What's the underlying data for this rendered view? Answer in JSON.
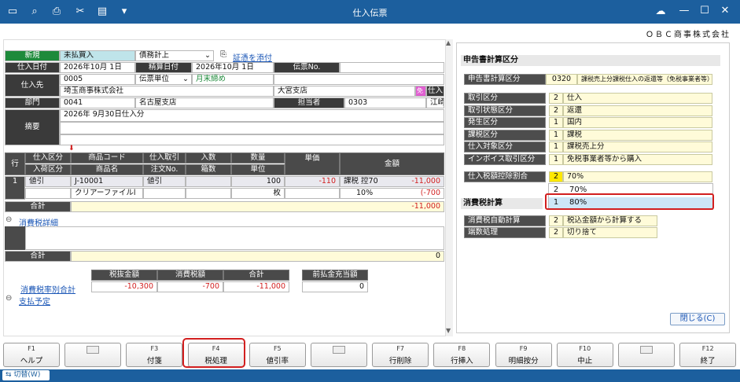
{
  "window": {
    "title": "仕入伝票"
  },
  "company": "ＯＢＣ商事株式会社",
  "header": {
    "new_label": "新規",
    "type_value": "未払買入",
    "debt_value": "債務計上",
    "attach_link": "証憑を添付",
    "date_label": "仕入日付",
    "date_value": "2026年10月  1日",
    "settle_label": "精算日付",
    "settle_value": "2026年10月  1日",
    "slip_label": "伝票No.",
    "supplier_label": "仕入先",
    "supplier_code": "0005",
    "slip_unit": "伝票単位",
    "closing": "月末締め",
    "supplier_name": "埼玉商事株式会社",
    "branch": "大宮支店",
    "badge": "免",
    "partial_right": "仕入",
    "dept_label": "部門",
    "dept_code": "0041",
    "dept_name": "名古屋支店",
    "person_label": "担当者",
    "person_code": "0303",
    "person_name": "江崎",
    "memo_label": "摘要",
    "memo_value": "2026年 9月30日仕入分"
  },
  "grid": {
    "h": {
      "row": "行",
      "kubun": "仕入区分",
      "nyuka": "入荷区分",
      "code": "商品コード",
      "name": "商品名",
      "torihiki": "仕入取引",
      "chumon": "注文No.",
      "irisu": "入数",
      "hakosu": "箱数",
      "suryo": "数量",
      "tani": "単位",
      "tanka": "単価",
      "kingaku": "金額"
    },
    "row": {
      "no": "1",
      "kubun": "値引",
      "code": "J-10001",
      "name": "クリアーファイルl",
      "torihiki": "値引",
      "qty": "100",
      "unit": "枚",
      "price": "-110",
      "tax": "課税 控70",
      "rate": "10%",
      "amount": "-11,000",
      "tax_amount": "(-700"
    },
    "total_label": "合計",
    "total_value": "-11,000"
  },
  "tax_detail": {
    "link": "消費税詳細",
    "total_label": "合計",
    "total_value": "0"
  },
  "summary": {
    "link": "消費税率別合計",
    "h1": "税抜金額",
    "h2": "消費税額",
    "h3": "合計",
    "h4": "前払金充当額",
    "v1": "-10,300",
    "v2": "-700",
    "v3": "-11,000",
    "v4": "0"
  },
  "payment_link": "支払予定",
  "right_panel": {
    "section1": "申告書計算区分",
    "shinkoku_label": "申告書計算区分",
    "shinkoku_code": "0320",
    "shinkoku_value": "課税売上分課税仕入の返還等（免税事業者等）",
    "rows": [
      {
        "label": "取引区分",
        "num": "2",
        "value": "仕入"
      },
      {
        "label": "取引状態区分",
        "num": "2",
        "value": "返還"
      },
      {
        "label": "発生区分",
        "num": "1",
        "value": "国内"
      },
      {
        "label": "課税区分",
        "num": "1",
        "value": "課税"
      },
      {
        "label": "仕入対象区分",
        "num": "1",
        "value": "課税売上分"
      },
      {
        "label": "インボイス取引区分",
        "num": "1",
        "value": "免税事業者等から購入"
      }
    ],
    "ratio_label": "仕入税額控除割合",
    "ratio_num": "2",
    "ratio_value": "70%",
    "dropdown": [
      {
        "num": "2",
        "value": "70%"
      },
      {
        "num": "1",
        "value": "80%"
      }
    ],
    "section2": "消費税計算",
    "auto_label": "消費税自動計算",
    "auto_num": "2",
    "auto_value": "税込金額から計算する",
    "round_label": "端数処理",
    "round_num": "2",
    "round_value": "切り捨て",
    "close_button": "閉じる(C)"
  },
  "fkeys": [
    {
      "key": "F1",
      "label": "ヘルプ"
    },
    {
      "key": "",
      "label": ""
    },
    {
      "key": "F3",
      "label": "付箋"
    },
    {
      "key": "F4",
      "label": "税処理"
    },
    {
      "key": "F5",
      "label": "値引率"
    },
    {
      "key": "",
      "label": ""
    },
    {
      "key": "F7",
      "label": "行削除"
    },
    {
      "key": "F8",
      "label": "行挿入"
    },
    {
      "key": "F9",
      "label": "明細按分"
    },
    {
      "key": "F10",
      "label": "中止"
    },
    {
      "key": "",
      "label": ""
    },
    {
      "key": "F12",
      "label": "終了"
    }
  ],
  "status": {
    "switch_label": "切替(W)"
  },
  "colors": {
    "titlebar": "#1c5f9e",
    "highlight": "#d21f1f",
    "accent_green": "#1e8a3b"
  }
}
